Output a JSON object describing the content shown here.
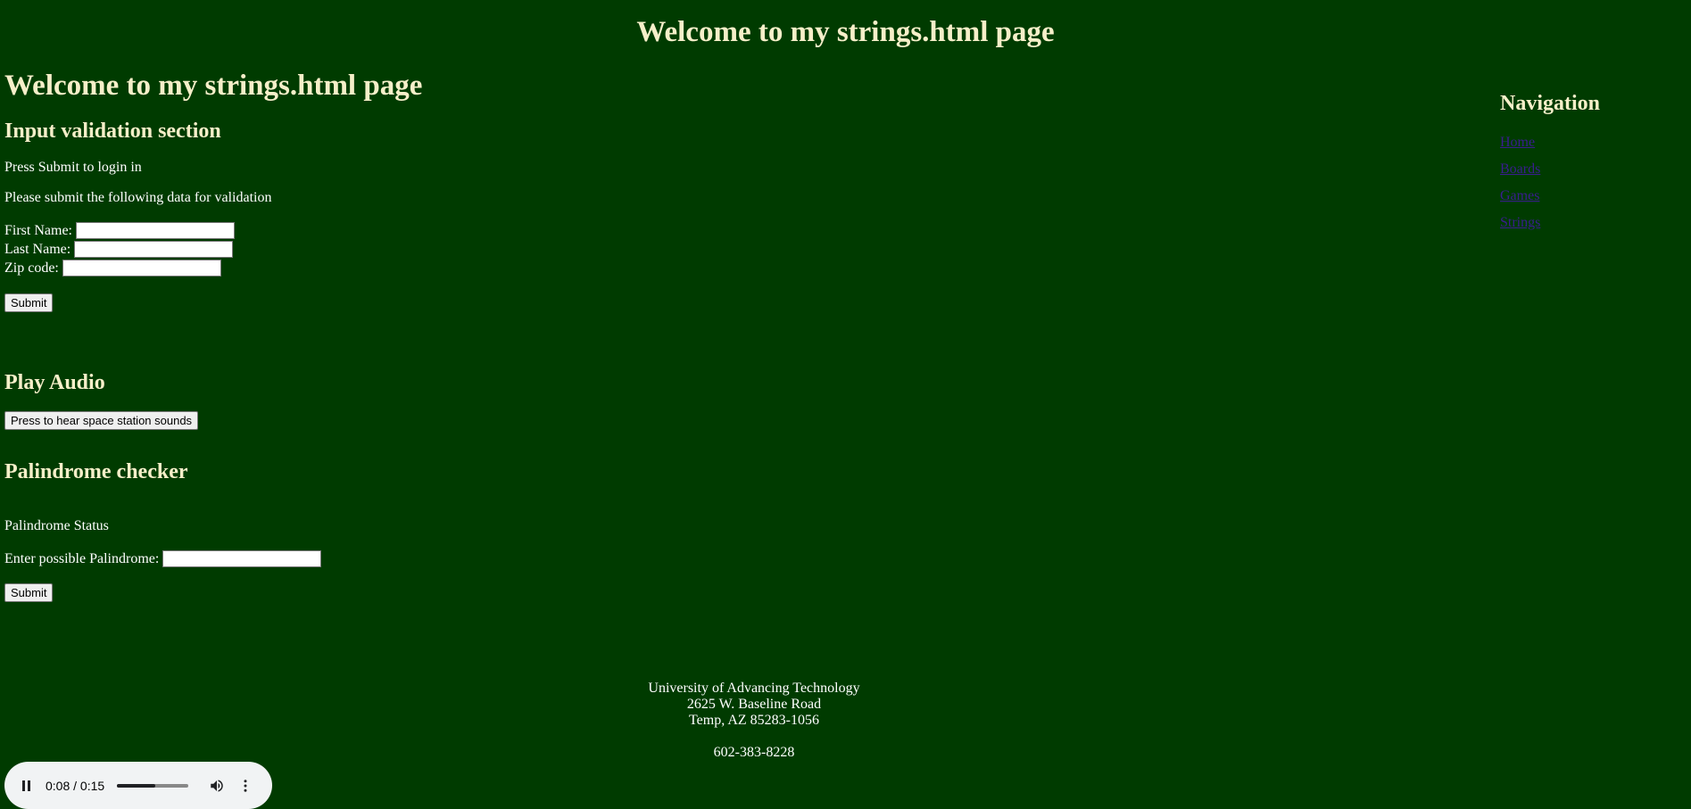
{
  "header": {
    "title": "Welcome to my strings.html page"
  },
  "main": {
    "heading": "Welcome to my strings.html page",
    "validation": {
      "title": "Input validation section",
      "intro": "Press Submit to login in",
      "instructions": "Please submit the following data for validation",
      "first_name_label": "First Name:",
      "first_name_value": "",
      "last_name_label": "Last Name:",
      "last_name_value": "",
      "zip_label": "Zip code:",
      "zip_value": "",
      "submit_label": "Submit"
    },
    "audio_section": {
      "title": "Play Audio",
      "button_label": "Press to hear space station sounds"
    },
    "palindrome": {
      "title": "Palindrome checker",
      "status": "Palindrome Status",
      "input_label": "Enter possible Palindrome:",
      "input_value": "",
      "submit_label": "Submit"
    }
  },
  "nav": {
    "title": "Navigation",
    "items": [
      {
        "label": "Home"
      },
      {
        "label": "Boards"
      },
      {
        "label": "Games"
      },
      {
        "label": "Strings"
      }
    ]
  },
  "footer": {
    "line1": "University of Advancing Technology",
    "line2": "2625 W. Baseline Road",
    "line3": "Temp, AZ 85283-1056",
    "phone": "602-383-8228"
  },
  "audio_player": {
    "time": "0:08 / 0:15",
    "progress": 0.53,
    "play_state_icon": "pause-icon",
    "volume_icon": "volume-icon",
    "menu_icon": "more-vertical-icon"
  }
}
